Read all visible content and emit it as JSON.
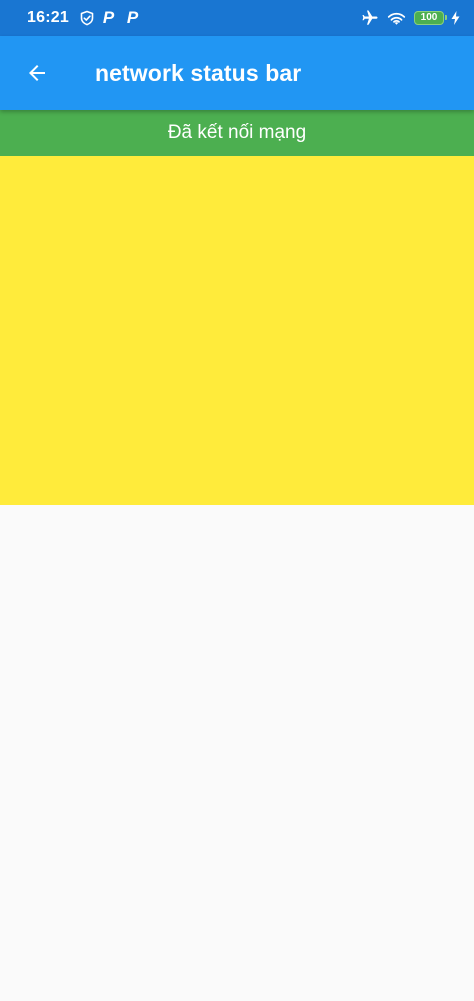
{
  "status_bar": {
    "time": "16:21",
    "left_icons": [
      "shield-check-icon",
      "p-icon",
      "p-icon"
    ],
    "p_icon_letter": "P",
    "right_icons": [
      "airplane-icon",
      "wifi-icon",
      "battery-icon",
      "charging-icon"
    ],
    "battery_level": "100",
    "background": "#1976D2"
  },
  "app_bar": {
    "title": "network status bar",
    "back_icon": "arrow-back-icon",
    "background": "#2196F3"
  },
  "network_status": {
    "text": "Đã kết nối mạng",
    "background": "#4CAF50"
  },
  "content": {
    "panel_color": "#FFEB3B",
    "page_background": "#FAFAFA"
  }
}
